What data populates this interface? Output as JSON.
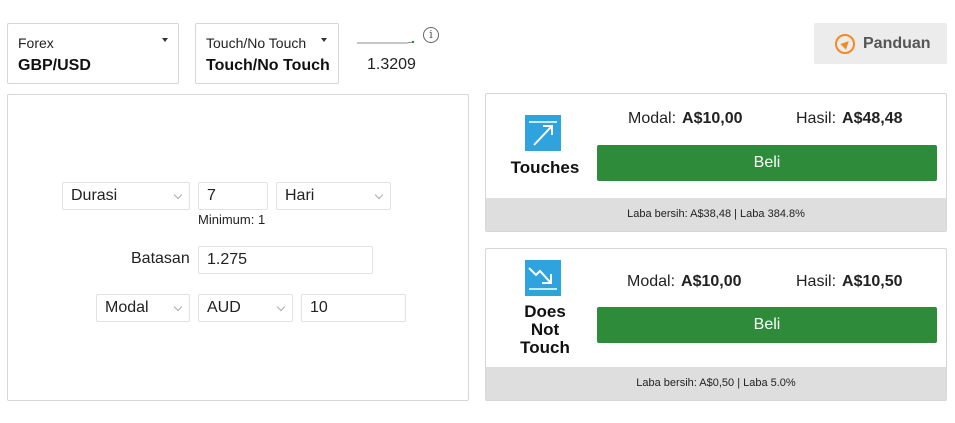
{
  "market_select": {
    "category": "Forex",
    "value": "GBP/USD"
  },
  "contract_type_select": {
    "category": "Touch/No Touch",
    "value": "Touch/No Touch"
  },
  "spot_price": "1.3209",
  "info_icon_glyph": "i",
  "guide_button": {
    "label": "Panduan",
    "icon": "compass-icon",
    "icon_color": "#f08a24"
  },
  "form": {
    "duration_type": "Durasi",
    "duration_value": "7",
    "duration_unit": "Hari",
    "minimum_label": "Minimum: 1",
    "barrier_label": "Batasan",
    "barrier_value": "1.275",
    "basis": "Modal",
    "currency": "AUD",
    "amount": "10"
  },
  "contracts": [
    {
      "name": "Touches",
      "icon": "touch-arrow-up-icon",
      "stake_label": "Modal:",
      "stake_value": "A$10,00",
      "payout_label": "Hasil:",
      "payout_value": "A$48,48",
      "buy_label": "Beli",
      "footer": "Laba bersih:  A$38,48 | Laba 384.8%"
    },
    {
      "name": "Does Not Touch",
      "name_lines": [
        "Does",
        "Not",
        "Touch"
      ],
      "icon": "no-touch-arrow-down-icon",
      "stake_label": "Modal:",
      "stake_value": "A$10,00",
      "payout_label": "Hasil:",
      "payout_value": "A$10,50",
      "buy_label": "Beli",
      "footer": "Laba bersih:  A$0,50 | Laba 5.0%"
    }
  ],
  "colors": {
    "buy_green": "#2e8b3a",
    "icon_blue": "#2ea3de",
    "footer_gray": "#dedede",
    "guide_bg": "#ececec"
  }
}
